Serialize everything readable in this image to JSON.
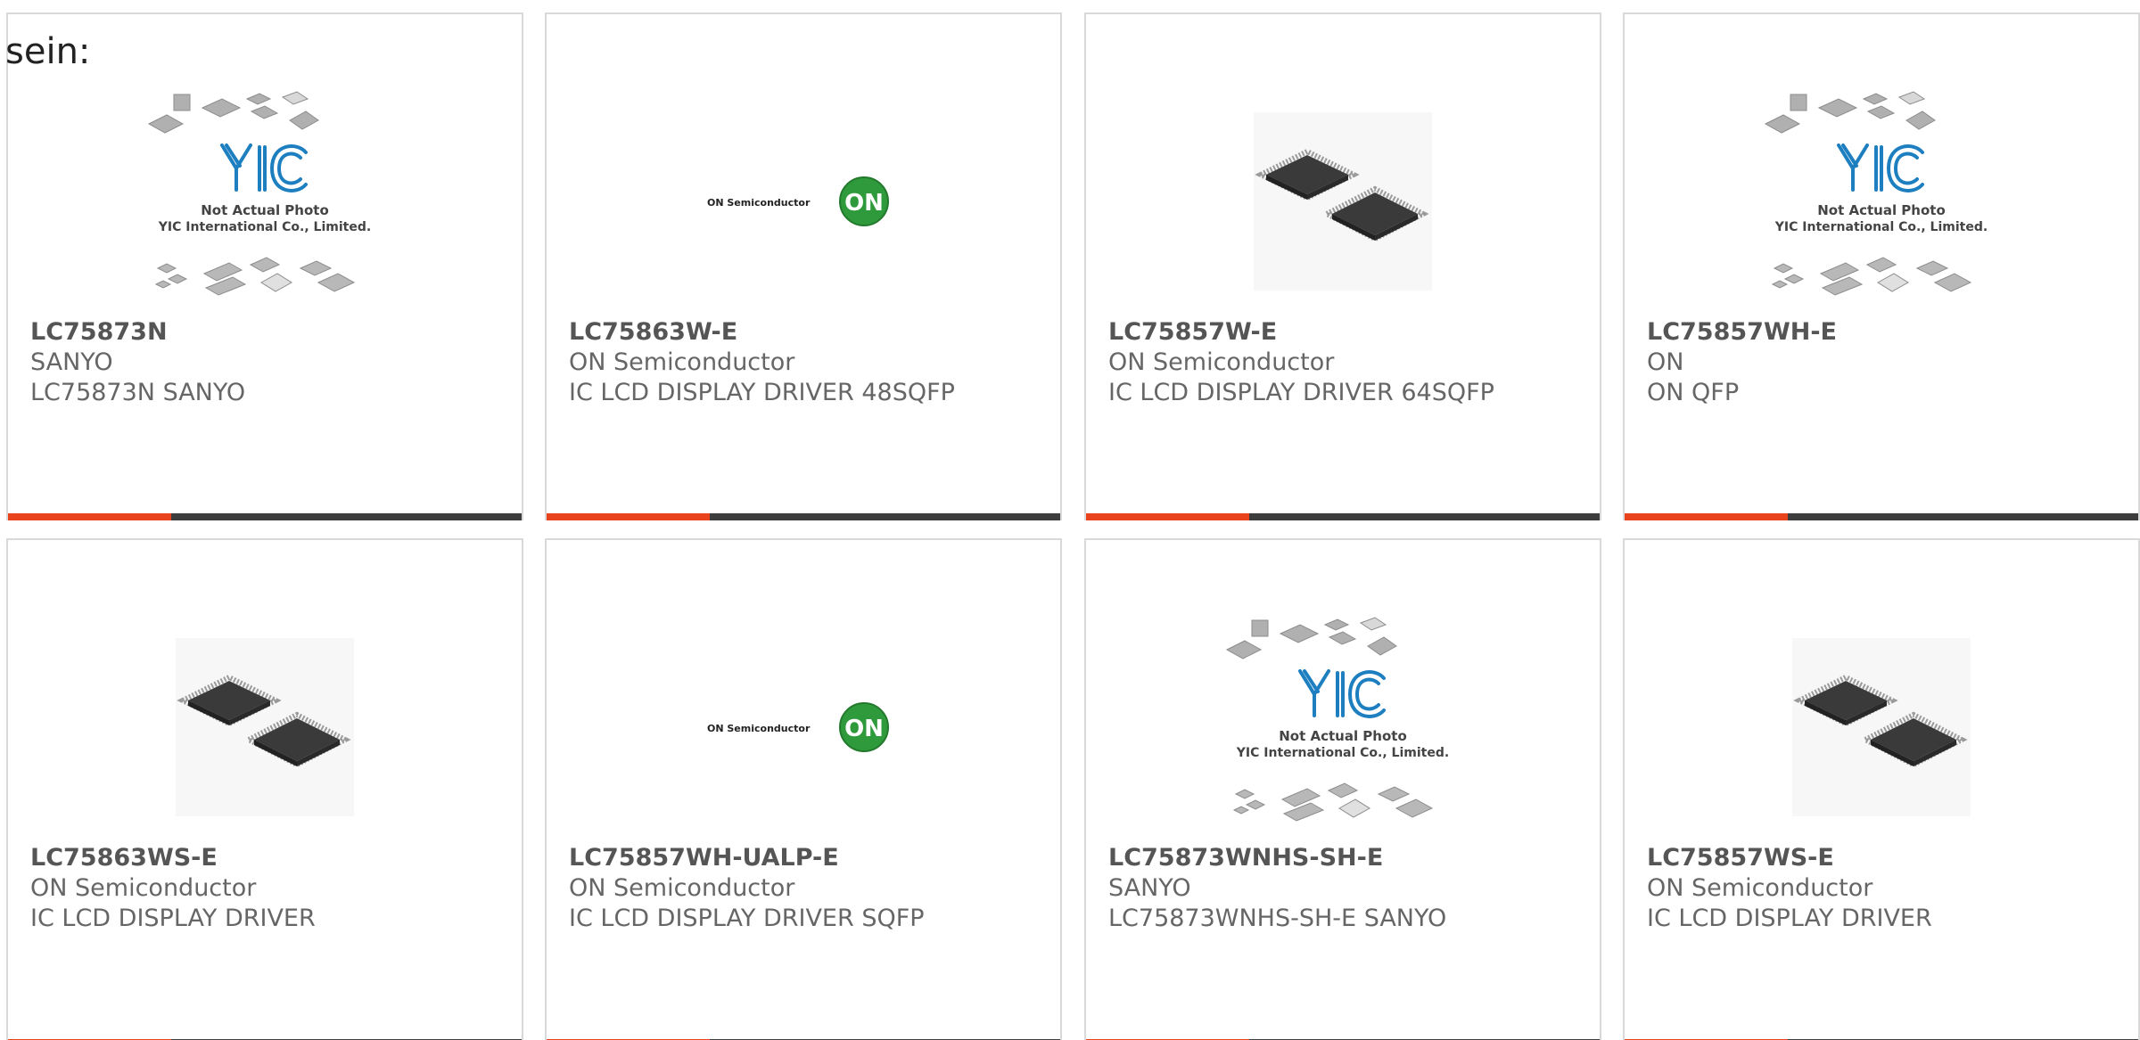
{
  "intro_text": "sein:",
  "colors": {
    "accent": "#e8431c",
    "bar_dark": "#3d3d3d",
    "yic_blue": "#1e7fc0",
    "on_green": "#2f9a3b"
  },
  "placeholder": {
    "line1": "Not Actual Photo",
    "line2": "YIC International Co., Limited.",
    "logo": "YIC"
  },
  "on_logo": {
    "wordmark": "ON Semiconductor",
    "badge": "ON"
  },
  "products": [
    {
      "part": "LC75873N",
      "manufacturer": "SANYO",
      "description": "LC75873N SANYO",
      "image": "yic-placeholder"
    },
    {
      "part": "LC75863W-E",
      "manufacturer": "ON Semiconductor",
      "description": "IC LCD DISPLAY DRIVER 48SQFP",
      "image": "on-semi-logo"
    },
    {
      "part": "LC75857W-E",
      "manufacturer": "ON Semiconductor",
      "description": "IC LCD DISPLAY DRIVER 64SQFP",
      "image": "qfp-chips-photo"
    },
    {
      "part": "LC75857WH-E",
      "manufacturer": "ON",
      "description": "ON QFP",
      "image": "yic-placeholder"
    },
    {
      "part": "LC75863WS-E",
      "manufacturer": "ON Semiconductor",
      "description": "IC LCD DISPLAY DRIVER",
      "image": "qfp-chips-photo"
    },
    {
      "part": "LC75857WH-UALP-E",
      "manufacturer": "ON Semiconductor",
      "description": "IC LCD DISPLAY DRIVER SQFP",
      "image": "on-semi-logo"
    },
    {
      "part": "LC75873WNHS-SH-E",
      "manufacturer": "SANYO",
      "description": "LC75873WNHS-SH-E SANYO",
      "image": "yic-placeholder"
    },
    {
      "part": "LC75857WS-E",
      "manufacturer": "ON Semiconductor",
      "description": "IC LCD DISPLAY DRIVER",
      "image": "qfp-chips-photo"
    }
  ]
}
